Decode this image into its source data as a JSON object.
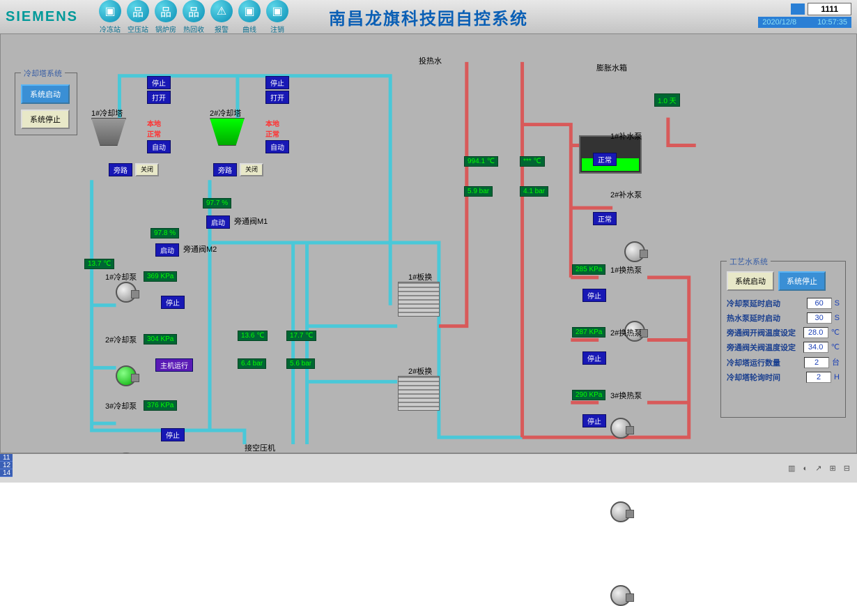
{
  "header": {
    "logo": "SIEMENS",
    "title": "南昌龙旗科技园自控系统",
    "nav": [
      "冷冻站",
      "空压站",
      "锅炉房",
      "热回收",
      "报警",
      "曲线",
      "注销"
    ],
    "user": "1111",
    "date": "2020/12/8",
    "time": "10:57:35"
  },
  "leftPanel": {
    "title": "冷却塔系统",
    "startBtn": "系统启动",
    "stopBtn": "系统停止"
  },
  "towers": {
    "t1": {
      "name": "1#冷却塔",
      "s1": "停止",
      "s2": "打开",
      "fault": "本地",
      "mode": "正常",
      "auto": "自动",
      "b1": "旁路",
      "b2": "关闭"
    },
    "t2": {
      "name": "2#冷却塔",
      "s1": "停止",
      "s2": "打开",
      "fault": "本地",
      "mode": "正常",
      "auto": "自动",
      "b1": "旁路",
      "b2": "关闭"
    }
  },
  "bypass": {
    "v1": {
      "pct": "97.7 %",
      "label": "旁通阀M1",
      "btn": "启动"
    },
    "v2": {
      "pct": "97.8 %",
      "label": "旁通阀M2",
      "btn": "启动"
    }
  },
  "coolPumps": {
    "tIn": "13.7 ℃",
    "p1": {
      "name": "1#冷却泵",
      "kpa": "369 KPa",
      "state": "停止"
    },
    "p2": {
      "name": "2#冷却泵",
      "kpa": "304 KPa",
      "state": "主机运行"
    },
    "p3": {
      "name": "3#冷却泵",
      "kpa": "376 KPa",
      "state": "停止"
    }
  },
  "midSensors": {
    "t1": "13.6 ℃",
    "t2": "17.7 ℃",
    "b1": "6.4 bar",
    "b2": "5.6 bar",
    "compressor": "接空压机"
  },
  "hotWater": {
    "label": "投热水",
    "t1": "994.1 ℃",
    "t2": "*** ℃",
    "b1": "5.9 bar",
    "b2": "4.1 bar"
  },
  "exchangers": {
    "e1": "1#板换",
    "e2": "2#板换"
  },
  "expTank": {
    "label": "膨胀水箱",
    "days": "1.0 天"
  },
  "supplyPumps": {
    "p1": {
      "name": "1#补水泵",
      "state": "正常"
    },
    "p2": {
      "name": "2#补水泵",
      "state": "正常"
    }
  },
  "heatPumps": {
    "p1": {
      "name": "1#换热泵",
      "kpa": "285 KPa",
      "state": "停止"
    },
    "p2": {
      "name": "2#换热泵",
      "kpa": "287 KPa",
      "state": "停止"
    },
    "p3": {
      "name": "3#换热泵",
      "kpa": "290 KPa",
      "state": "停止"
    }
  },
  "rightPanel": {
    "title": "工艺水系统",
    "startBtn": "系统启动",
    "stopBtn": "系统停止",
    "rows": [
      {
        "label": "冷却泵延时启动",
        "val": "60",
        "unit": "S"
      },
      {
        "label": "热水泵延时启动",
        "val": "30",
        "unit": "S"
      },
      {
        "label": "旁通阀开阀温度设定",
        "val": "28.0",
        "unit": "℃"
      },
      {
        "label": "旁通阀关阀温度设定",
        "val": "34.0",
        "unit": "℃"
      },
      {
        "label": "冷却塔运行数量",
        "val": "2",
        "unit": "台"
      },
      {
        "label": "冷却塔轮询时间",
        "val": "2",
        "unit": "H"
      }
    ]
  },
  "footer": {
    "r1": "11",
    "r2": "12",
    "r3": "14"
  }
}
